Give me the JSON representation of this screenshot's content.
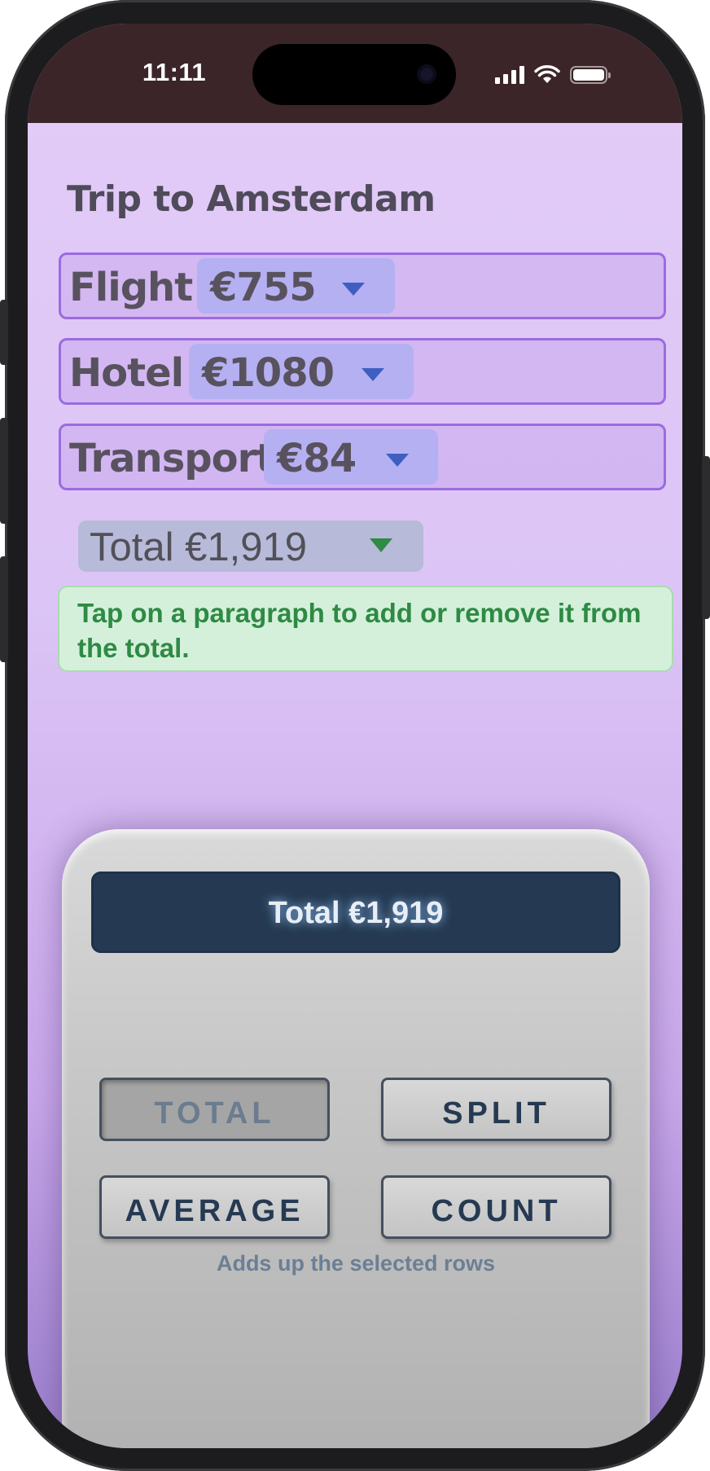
{
  "status_bar": {
    "time": "11:11"
  },
  "trip": {
    "title": "Trip to Amsterdam",
    "rows": [
      {
        "label": "Flight",
        "amount": "€755"
      },
      {
        "label": "Hotel",
        "amount": "€1080"
      },
      {
        "label": "Transport",
        "amount": "€84"
      }
    ],
    "total_label": "Total €1,919",
    "hint": "Tap on a paragraph to add or remove it from the total."
  },
  "calculator": {
    "display": "Total €1,919",
    "buttons": {
      "total": "TOTAL",
      "split": "SPLIT",
      "average": "AVERAGE",
      "count": "COUNT"
    },
    "active_button": "TOTAL",
    "caption": "Adds up the selected rows"
  },
  "colors": {
    "status_bar": "#3b2529",
    "row_border": "#9b6be0",
    "amount_pill": "#b5b0f2",
    "hint_text": "#2e8a44",
    "display_bg": "#253a52"
  },
  "icons": [
    "dropdown-caret-icon",
    "cellular-signal-icon",
    "wifi-icon",
    "battery-icon"
  ]
}
